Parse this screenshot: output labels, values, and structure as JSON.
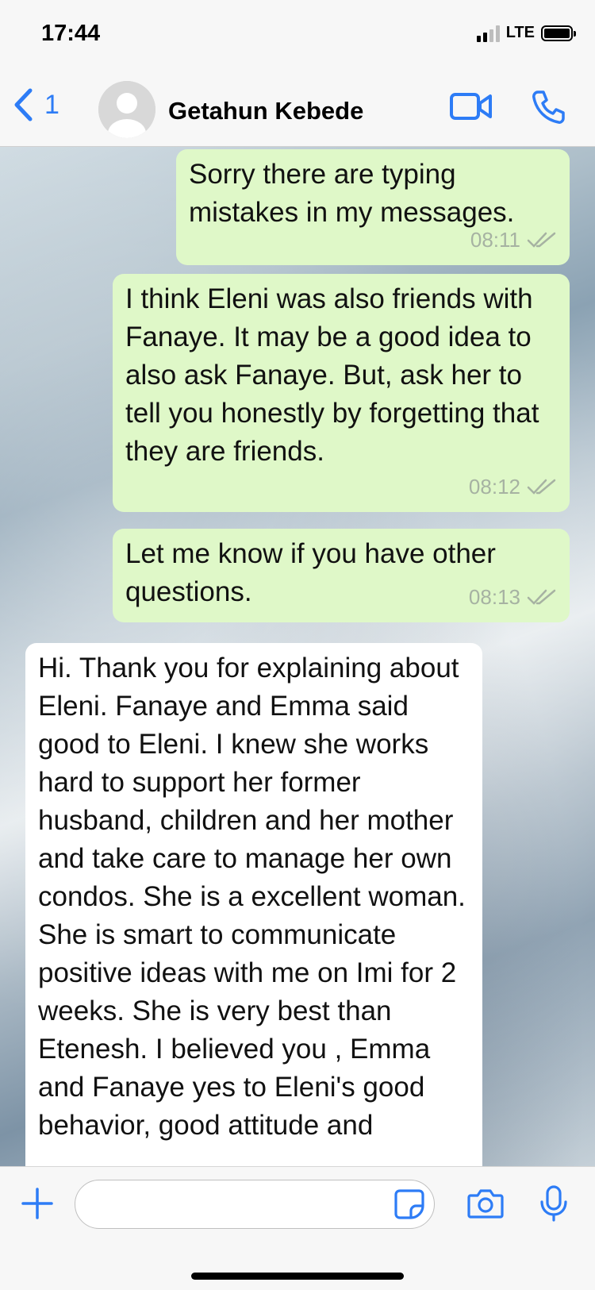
{
  "status_bar": {
    "time": "17:44",
    "network": "LTE",
    "signal_bars_active": 2,
    "signal_bars_total": 4,
    "battery_level": 0.9
  },
  "header": {
    "back_count": "1",
    "contact_name": "Getahun Kebede",
    "icons": {
      "back": "chevron-left-icon",
      "avatar": "avatar-placeholder",
      "video": "video-call-icon",
      "phone": "phone-call-icon"
    },
    "accent_color": "#2d7cf6"
  },
  "messages": [
    {
      "direction": "outgoing",
      "text": "Sorry there are typing mistakes in my messages.",
      "time": "08:11",
      "status": "read"
    },
    {
      "direction": "outgoing",
      "text": "I think Eleni was also friends with Fanaye. It may be a good idea to also ask Fanaye. But, ask her to tell you honestly by forgetting that they are friends.",
      "time": "08:12",
      "status": "read"
    },
    {
      "direction": "outgoing",
      "text": "Let me know if you have other questions.",
      "time": "08:13",
      "status": "read"
    },
    {
      "direction": "incoming",
      "text": "Hi. Thank you for explaining about Eleni. Fanaye and Emma said good to Eleni. I knew she works hard to support her former husband, children and her mother and take care to manage her own condos. She is a excellent woman. She is smart to communicate positive ideas with me on Imi for 2 weeks. She is very best than Etenesh. I believed you , Emma and Fanaye yes to Eleni's good behavior, good attitude and"
    }
  ],
  "colors": {
    "outgoing_bubble": "#dff8c8",
    "incoming_bubble": "#ffffff",
    "meta_text": "#a6b2a2"
  },
  "composer": {
    "placeholder": "",
    "icons": [
      "plus-icon",
      "sticker-icon",
      "camera-icon",
      "microphone-icon"
    ]
  }
}
